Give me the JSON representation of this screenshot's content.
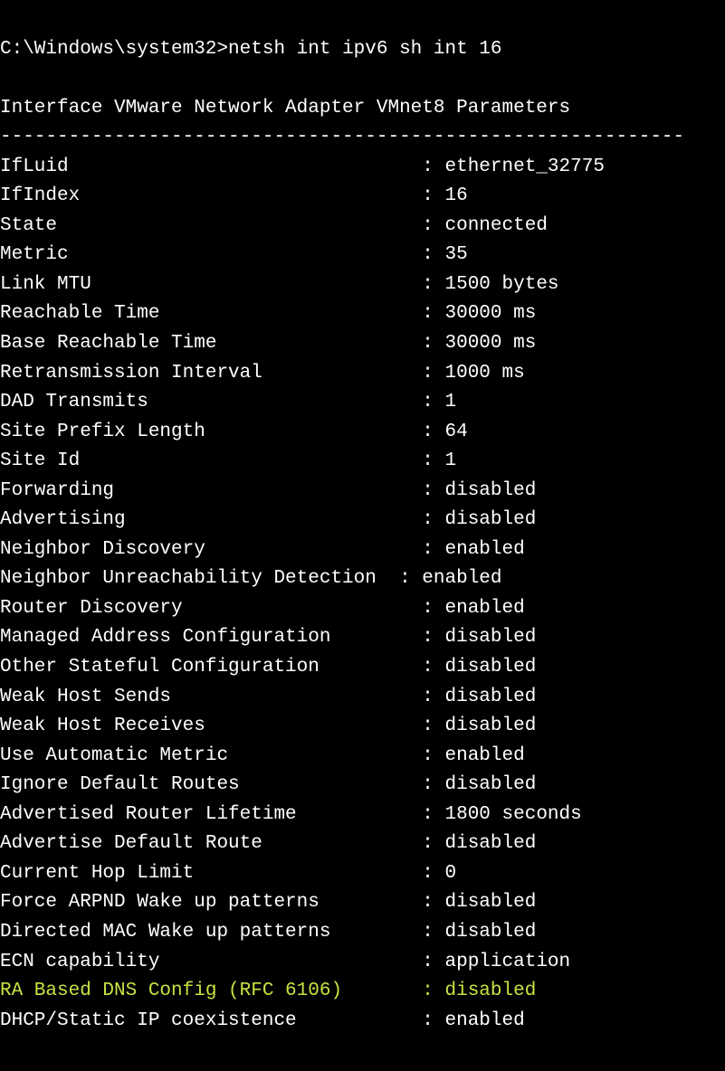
{
  "prompt": "C:\\Windows\\system32>",
  "command": "netsh int ipv6 sh int 16",
  "blank": "",
  "header": "Interface VMware Network Adapter VMnet8 Parameters",
  "separator": "------------------------------------------------------------",
  "label_col_width": 37,
  "rows": [
    {
      "label": "IfLuid",
      "sep": ": ",
      "value": "ethernet_32775",
      "hl": false
    },
    {
      "label": "IfIndex",
      "sep": ": ",
      "value": "16",
      "hl": false
    },
    {
      "label": "State",
      "sep": ": ",
      "value": "connected",
      "hl": false
    },
    {
      "label": "Metric",
      "sep": ": ",
      "value": "35",
      "hl": false
    },
    {
      "label": "Link MTU",
      "sep": ": ",
      "value": "1500 bytes",
      "hl": false
    },
    {
      "label": "Reachable Time",
      "sep": ": ",
      "value": "30000 ms",
      "hl": false
    },
    {
      "label": "Base Reachable Time",
      "sep": ": ",
      "value": "30000 ms",
      "hl": false
    },
    {
      "label": "Retransmission Interval",
      "sep": ": ",
      "value": "1000 ms",
      "hl": false
    },
    {
      "label": "DAD Transmits",
      "sep": ": ",
      "value": "1",
      "hl": false
    },
    {
      "label": "Site Prefix Length",
      "sep": ": ",
      "value": "64",
      "hl": false
    },
    {
      "label": "Site Id",
      "sep": ": ",
      "value": "1",
      "hl": false
    },
    {
      "label": "Forwarding",
      "sep": ": ",
      "value": "disabled",
      "hl": false
    },
    {
      "label": "Advertising",
      "sep": ": ",
      "value": "disabled",
      "hl": false
    },
    {
      "label": "Neighbor Discovery",
      "sep": ": ",
      "value": "enabled",
      "hl": false
    },
    {
      "label": "Neighbor Unreachability Detection  ",
      "sep": ": ",
      "value": "enabled",
      "hl": false,
      "rawLabel": true
    },
    {
      "label": "Router Discovery",
      "sep": ": ",
      "value": "enabled",
      "hl": false
    },
    {
      "label": "Managed Address Configuration",
      "sep": ": ",
      "value": "disabled",
      "hl": false
    },
    {
      "label": "Other Stateful Configuration",
      "sep": ": ",
      "value": "disabled",
      "hl": false
    },
    {
      "label": "Weak Host Sends",
      "sep": ": ",
      "value": "disabled",
      "hl": false
    },
    {
      "label": "Weak Host Receives",
      "sep": ": ",
      "value": "disabled",
      "hl": false
    },
    {
      "label": "Use Automatic Metric",
      "sep": ": ",
      "value": "enabled",
      "hl": false
    },
    {
      "label": "Ignore Default Routes",
      "sep": ": ",
      "value": "disabled",
      "hl": false
    },
    {
      "label": "Advertised Router Lifetime",
      "sep": ": ",
      "value": "1800 seconds",
      "hl": false
    },
    {
      "label": "Advertise Default Route",
      "sep": ": ",
      "value": "disabled",
      "hl": false
    },
    {
      "label": "Current Hop Limit",
      "sep": ": ",
      "value": "0",
      "hl": false
    },
    {
      "label": "Force ARPND Wake up patterns",
      "sep": ": ",
      "value": "disabled",
      "hl": false
    },
    {
      "label": "Directed MAC Wake up patterns",
      "sep": ": ",
      "value": "disabled",
      "hl": false
    },
    {
      "label": "ECN capability",
      "sep": ": ",
      "value": "application",
      "hl": false
    },
    {
      "label": "RA Based DNS Config (RFC 6106)",
      "sep": ": ",
      "value": "disabled",
      "hl": true
    },
    {
      "label": "DHCP/Static IP coexistence",
      "sep": ": ",
      "value": "enabled",
      "hl": false
    }
  ]
}
